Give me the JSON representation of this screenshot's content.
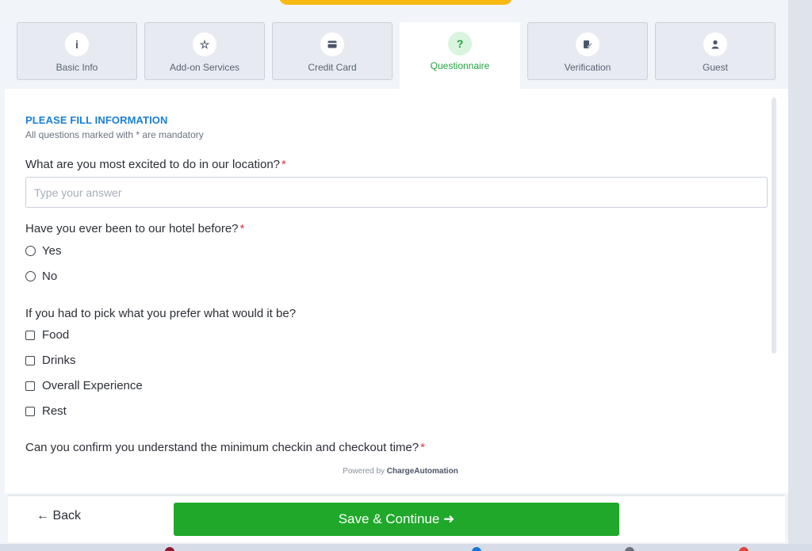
{
  "tabs": [
    {
      "label": "Basic Info",
      "icon": "info-icon",
      "glyph": "i"
    },
    {
      "label": "Add-on Services",
      "icon": "star-icon",
      "glyph": "☆"
    },
    {
      "label": "Credit Card",
      "icon": "credit-card-icon",
      "glyph": "▭"
    },
    {
      "label": "Questionnaire",
      "icon": "question-icon",
      "glyph": "?"
    },
    {
      "label": "Verification",
      "icon": "document-edit-icon",
      "glyph": "✎"
    },
    {
      "label": "Guest",
      "icon": "user-icon",
      "glyph": "●"
    }
  ],
  "active_tab": "Questionnaire",
  "form": {
    "title": "PLEASE FILL INFORMATION",
    "subtitle": "All questions marked with * are mandatory",
    "q1": {
      "label": "What are you most excited to do in our location?",
      "required": "*",
      "placeholder": "Type your answer",
      "value": ""
    },
    "q2": {
      "label": "Have you ever been to our hotel before?",
      "required": "*",
      "options": [
        "Yes",
        "No"
      ]
    },
    "q3": {
      "label": "If you had to pick what you prefer what would it be?",
      "options": [
        "Food",
        "Drinks",
        "Overall Experience",
        "Rest"
      ]
    },
    "q4": {
      "label": "Can you confirm you understand the minimum checkin and checkout time?",
      "required": "*"
    }
  },
  "powered_by": {
    "prefix": "Powered by",
    "brand": "ChargeAutomation"
  },
  "footer": {
    "back_label": "← Back",
    "save_label": "Save & Continue ➜"
  },
  "colors": {
    "accent_green": "#1fa829",
    "title_blue": "#1a7fd6",
    "required_red": "#d93644",
    "top_pill_yellow": "#f8b913"
  }
}
